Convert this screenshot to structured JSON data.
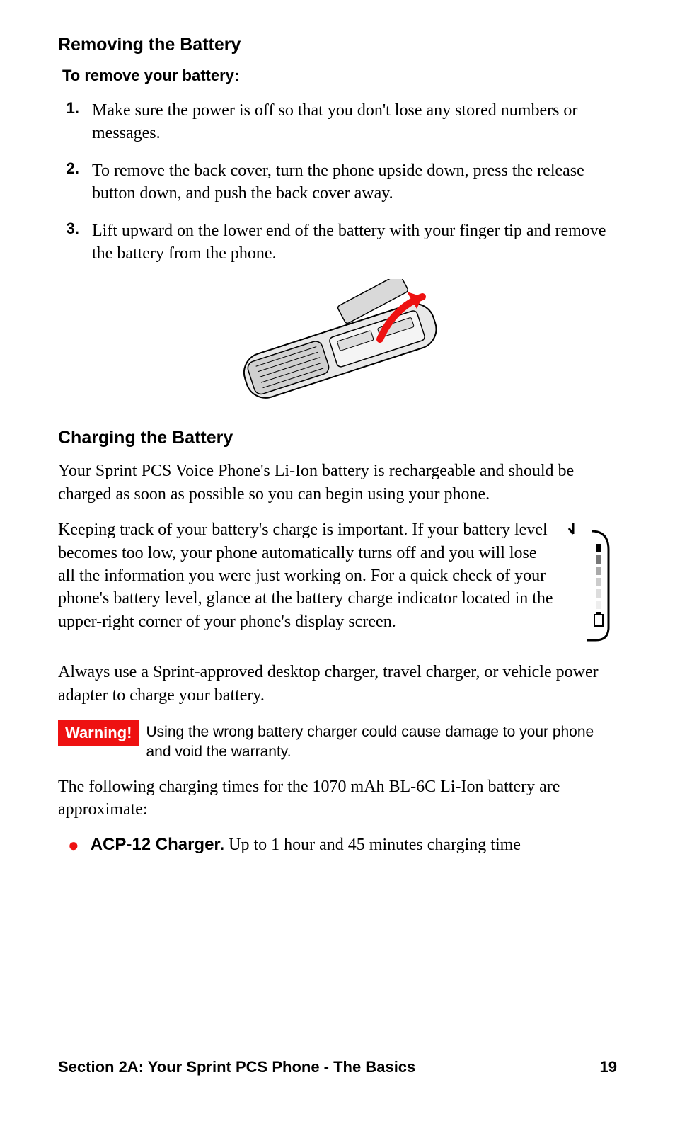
{
  "section1": {
    "heading": "Removing the Battery",
    "intro": "To remove your battery:",
    "steps": [
      {
        "num": "1.",
        "text": "Make sure the power is off so that you don't lose any stored numbers or messages."
      },
      {
        "num": "2.",
        "text": "To remove the back cover, turn the phone upside down, press the release button down, and push the back cover away."
      },
      {
        "num": "3.",
        "text": "Lift upward on the lower end of the battery with your finger tip and remove the battery from the phone."
      }
    ]
  },
  "section2": {
    "heading": "Charging the Battery",
    "para1": "Your Sprint PCS Voice Phone's Li-Ion battery is rechargeable and should be charged as soon as possible so you can begin using your phone.",
    "para2": "Keeping track of your battery's charge is important. If your battery level becomes too low, your phone automatically turns off and you will lose all the information you were just working on. For a quick check of your phone's battery level, glance at the battery charge indicator located in the upper-right corner of your phone's display screen.",
    "para3": "Always use a Sprint-approved desktop charger, travel charger, or vehicle power adapter to charge your battery.",
    "warning_label": "Warning!",
    "warning_text": "Using the wrong battery charger could cause damage to your phone and void the warranty.",
    "para4": "The following charging times for the 1070 mAh BL-6C Li-Ion battery are approximate:",
    "bullets": [
      {
        "label": "ACP-12 Charger.",
        "text": " Up to 1 hour and 45 minutes charging time"
      }
    ]
  },
  "footer": {
    "section": "Section 2A: Your Sprint PCS Phone - The Basics",
    "page": "19"
  }
}
